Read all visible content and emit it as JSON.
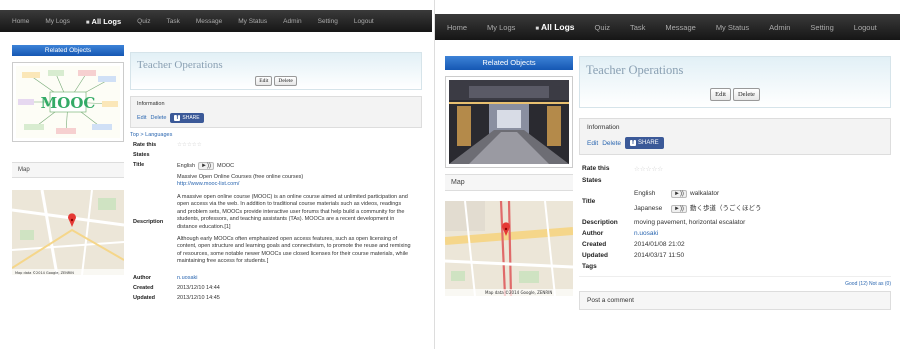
{
  "left": {
    "nav": [
      "Home",
      "My Logs",
      "All Logs",
      "Quiz",
      "Task",
      "Message",
      "My Status",
      "Admin",
      "Setting",
      "Logout"
    ],
    "active_nav": "All Logs",
    "related_objects": "Related Objects",
    "mooc_text": "MOOC",
    "map_label": "Map",
    "map_attr": "Map data ©2014 Google, ZENRIN",
    "title": "Teacher Operations",
    "edit": "Edit",
    "delete": "Delete",
    "information": "Information",
    "info_edit": "Edit",
    "info_delete": "Delete",
    "share": "SHARE",
    "breadcrumb": "Top > Languages",
    "fields": {
      "rate_label": "Rate this",
      "stars": "☆☆☆☆☆",
      "states_label": "States",
      "title_label": "Title",
      "title_lang": "English",
      "title_value": "MOOC",
      "desc_label": "Description",
      "desc_p1": "Massive Open Online Courses (free online courses)",
      "desc_link": "http://www.mooc-list.com/",
      "desc_p2": "A massive open online course (MOOC) is an online course aimed at unlimited participation and open access via the web. In addition to traditional course materials such as videos, readings and problem sets, MOOCs provide interactive user forums that help build a community for the students, professors, and teaching assistants (TAs). MOOCs are a recent development in distance education.[1]",
      "desc_p3": "Although early MOOCs often emphasized open access features, such as open licensing of content, open structure and learning goals and connectivism, to promote the reuse and remixing of resources, some notable newer MOOCs use closed licenses for their course materials, while maintaining free access for students.[",
      "author_label": "Author",
      "author": "n.uosaki",
      "created_label": "Created",
      "created": "2013/12/10 14:44",
      "updated_label": "Updated",
      "updated": "2013/12/10 14:45"
    }
  },
  "right": {
    "nav": [
      "Home",
      "My Logs",
      "All Logs",
      "Quiz",
      "Task",
      "Message",
      "My Status",
      "Admin",
      "Setting",
      "Logout"
    ],
    "active_nav": "All Logs",
    "related_objects": "Related Objects",
    "map_label": "Map",
    "map_attr": "Map data ©2014 Google, ZENRIN",
    "title": "Teacher Operations",
    "edit": "Edit",
    "delete": "Delete",
    "information": "Information",
    "info_edit": "Edit",
    "info_delete": "Delete",
    "share": "SHARE",
    "fields": {
      "rate_label": "Rate this",
      "stars": "☆☆☆☆☆",
      "states_label": "States",
      "title_label": "Title",
      "lang1": "English",
      "value1": "walkalator",
      "lang2": "Japanese",
      "value2": "動く歩道（うごくほどう",
      "desc_label": "Description",
      "desc": "moving pavement, horizontal escalator",
      "author_label": "Author",
      "author": "n.uosaki",
      "created_label": "Created",
      "created": "2014/01/08 21:02",
      "updated_label": "Updated",
      "updated": "2014/03/17 11:50",
      "tags_label": "Tags"
    },
    "bottom_links": "Good (12)  Not as (0)",
    "post_comment": "Post a comment"
  }
}
